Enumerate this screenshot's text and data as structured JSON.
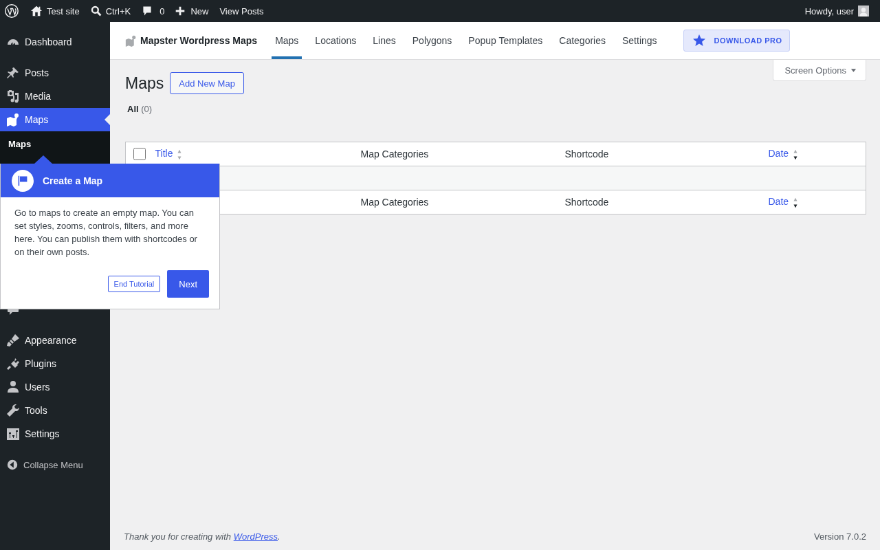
{
  "admin_bar": {
    "site_name": "Test site",
    "search_shortcut": "Ctrl+K",
    "comment_count": "0",
    "new_label": "New",
    "view_posts": "View Posts",
    "greeting": "Howdy, user"
  },
  "sidebar": {
    "groups": [
      {
        "items": [
          {
            "kind": "dashboard",
            "label": "Dashboard",
            "selected": false
          }
        ]
      },
      {
        "items": [
          {
            "kind": "posts",
            "label": "Posts",
            "selected": false
          },
          {
            "kind": "media",
            "label": "Media",
            "selected": false
          },
          {
            "kind": "maps",
            "label": "Maps",
            "selected": true,
            "children": [
              {
                "label": "Maps",
                "selected": true
              }
            ]
          },
          {
            "kind": "comments",
            "selected": false
          }
        ]
      },
      {
        "items": [
          {
            "kind": "appearance",
            "label": "Appearance",
            "selected": false
          },
          {
            "kind": "plugins",
            "label": "Plugins",
            "selected": false
          },
          {
            "kind": "users",
            "label": "Users",
            "selected": false
          },
          {
            "kind": "tools",
            "label": "Tools",
            "selected": false
          },
          {
            "kind": "settings",
            "label": "Settings",
            "selected": false
          }
        ]
      }
    ],
    "collapse": "Collapse Menu"
  },
  "plugin_header": {
    "brand": "Mapster Wordpress Maps",
    "tabs": [
      {
        "label": "Maps",
        "selected": true
      },
      {
        "label": "Locations",
        "selected": false
      },
      {
        "label": "Lines",
        "selected": false
      },
      {
        "label": "Polygons",
        "selected": false
      },
      {
        "label": "Popup Templates",
        "selected": false
      },
      {
        "label": "Categories",
        "selected": false
      },
      {
        "label": "Settings",
        "selected": false
      }
    ],
    "pro_button": "DOWNLOAD PRO"
  },
  "screen_options": "Screen Options",
  "page": {
    "title": "Maps",
    "add_button": "Add New Map",
    "filters": [
      {
        "label": "All",
        "count": "(0)",
        "selected": true
      }
    ]
  },
  "table": {
    "select_all_checked": false,
    "columns": [
      {
        "label": "Title",
        "sortable": true,
        "sorted_desc": false
      },
      {
        "label": "Map Categories",
        "sortable": false
      },
      {
        "label": "Shortcode",
        "sortable": false
      },
      {
        "label": "Date",
        "sortable": true,
        "sorted_desc": true
      }
    ],
    "footer_columns": [
      {
        "label": "Map Categories",
        "sortable": false
      },
      {
        "label": "Shortcode",
        "sortable": false
      },
      {
        "label": "Date",
        "sortable": true,
        "sorted_desc": true
      }
    ]
  },
  "tour": {
    "title": "Create a Map",
    "text": "Go to maps to create an empty map. You can set styles, zooms, controls, filters, and more here. You can publish them with shortcodes or on their own posts.",
    "end_button": "End Tutorial",
    "next_button": "Next"
  },
  "footer": {
    "text_before": "Thank you for creating with ",
    "link": "WordPress",
    "text_after": ".",
    "version": "Version 7.0.2"
  }
}
